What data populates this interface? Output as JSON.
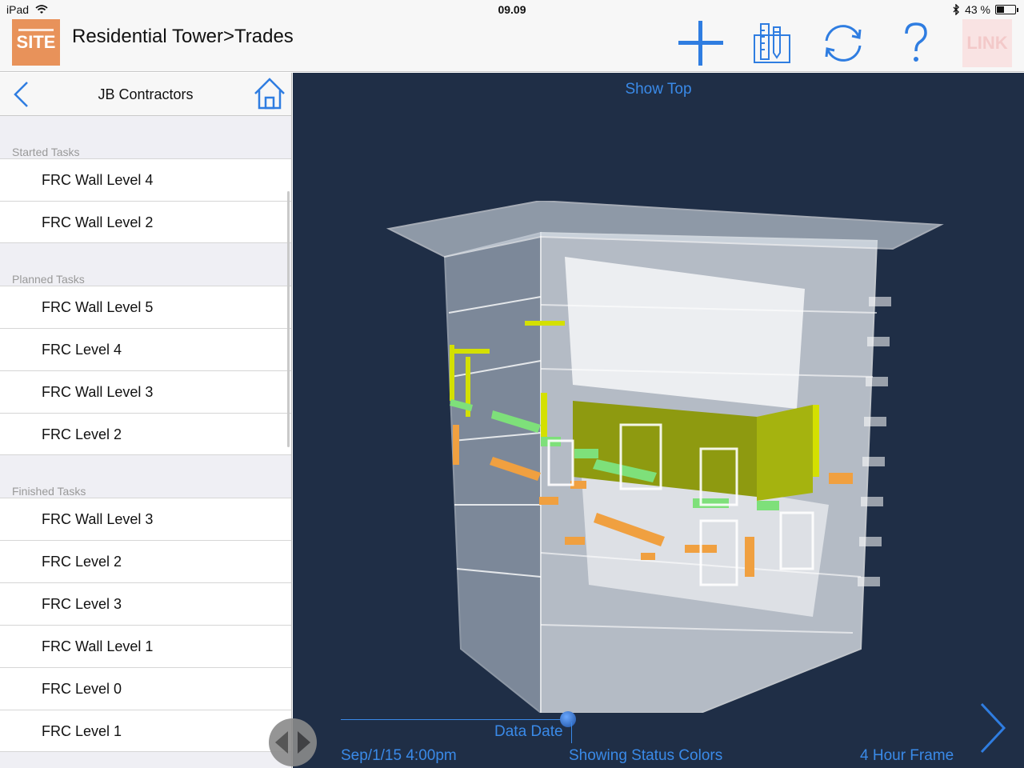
{
  "status_bar": {
    "device": "iPad",
    "time": "09.09",
    "battery_percent": "43 %",
    "battery_level": 0.43
  },
  "nav": {
    "logo_text": "SITE",
    "title": "Residential Tower>Trades",
    "link_logo_text": "LINK",
    "toolbar_icons": [
      "plus-icon",
      "ruler-pencil-icon",
      "sync-icon",
      "help-icon"
    ]
  },
  "sidebar": {
    "title": "JB Contractors",
    "sections": [
      {
        "header": "Started Tasks",
        "tasks": [
          "FRC Wall Level 4",
          "FRC Wall Level 2"
        ]
      },
      {
        "header": "Planned Tasks",
        "tasks": [
          "FRC Wall Level 5",
          "FRC Level 4",
          "FRC Wall Level 3",
          "FRC Level 2"
        ]
      },
      {
        "header": "Finished Tasks",
        "tasks": [
          "FRC Wall Level 3",
          "FRC Level 2",
          "FRC Level 3",
          "FRC Wall Level 1",
          "FRC Level 0",
          "FRC Level 1"
        ]
      }
    ]
  },
  "viewer": {
    "show_top_label": "Show Top",
    "data_date_label": "Data Date",
    "date_value": "Sep/1/15 4:00pm",
    "status_colors_label": "Showing Status Colors",
    "frame_label": "4 Hour Frame",
    "colors": {
      "background": "#1f2e46",
      "accent": "#3a8ae8",
      "started": "#c8d400",
      "planned": "#f0a040",
      "finished": "#7ee07a",
      "wall": "#8e9a10"
    }
  }
}
